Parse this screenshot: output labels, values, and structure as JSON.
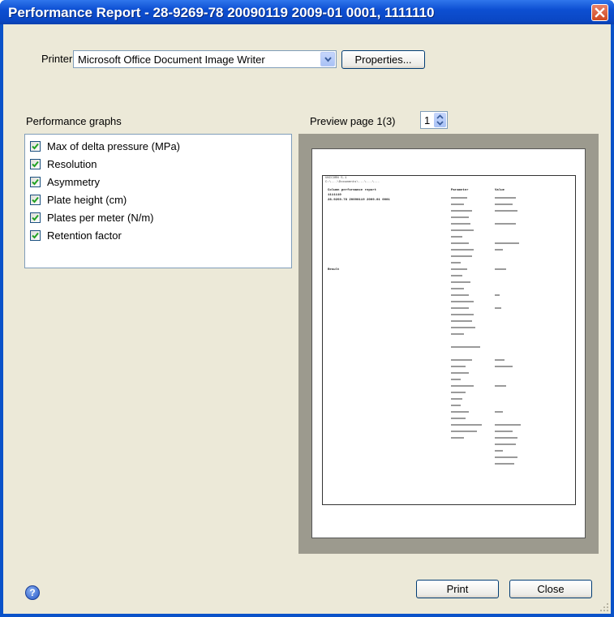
{
  "window": {
    "title": "Performance Report - 28-9269-78 20090119 2009-01 0001, 1111110",
    "close_icon": "close-icon",
    "accent": "#0A52C9"
  },
  "printer": {
    "label": "Printer:",
    "selected": "Microsoft Office Document Image Writer",
    "properties_label": "Properties..."
  },
  "graphs": {
    "heading": "Performance graphs",
    "items": [
      {
        "label": "Max of delta pressure (MPa)",
        "checked": true
      },
      {
        "label": "Resolution",
        "checked": true
      },
      {
        "label": "Asymmetry",
        "checked": true
      },
      {
        "label": "Plate height (cm)",
        "checked": true
      },
      {
        "label": "Plates per meter (N/m)",
        "checked": true
      },
      {
        "label": "Retention factor",
        "checked": true
      }
    ]
  },
  "preview": {
    "label": "Preview page 1(3)",
    "page_value": "1",
    "header_lines": [
      "UNICORN 5.1",
      "C:\\...\\Documents\\...\\...\\...",
      "",
      "Column performance report",
      "1111110",
      "28-9269-78 20090119 2009-01 0001"
    ],
    "params_heading": "Parameter",
    "values_heading": "Value",
    "result_label": "Result"
  },
  "footer": {
    "help_icon": "help-icon",
    "print_label": "Print",
    "close_label": "Close"
  }
}
